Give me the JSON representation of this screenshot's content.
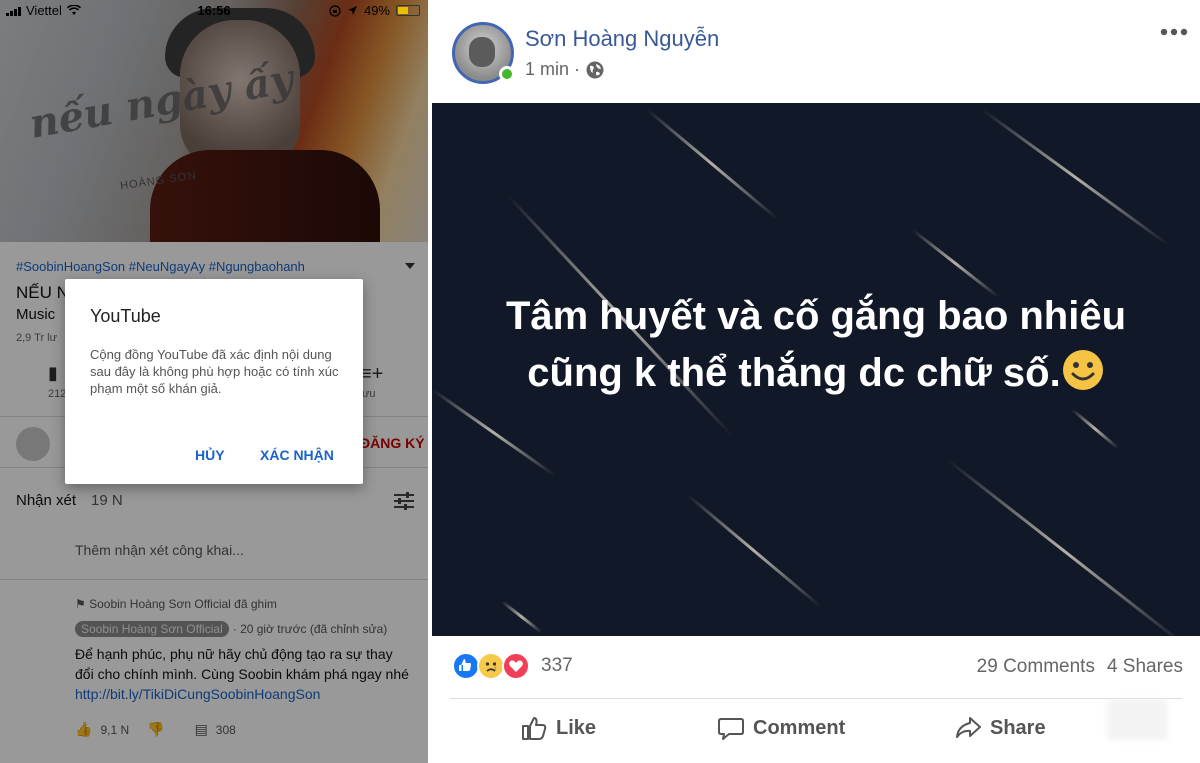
{
  "status_bar": {
    "carrier": "Viettel",
    "time": "16:56",
    "battery": "49%"
  },
  "youtube": {
    "thumbnail_title_art": "nếu ngày ấy",
    "thumbnail_artist_art": "HOÀNG SƠN",
    "hashtags": "#SoobinHoangSon #NeuNgayAy #Ngungbaohanh",
    "video_title_visible": "NẾU N",
    "video_subtitle_visible": "Music",
    "views_visible": "2,9 Tr lư",
    "like_count_visible": "212",
    "add_label_visible": "ưu",
    "subscribe_visible": "ĐĂNG KÝ",
    "comments_heading": "Nhận xét",
    "comments_count": "19 N",
    "add_comment_placeholder": "Thêm nhận xét công khai...",
    "pinned_by": "Soobin Hoàng Sơn Official đã ghim",
    "comment_author": "Soobin Hoàng Sơn Official",
    "comment_time": "· 20 giờ trước (đã chỉnh sửa)",
    "comment_text": "Để hạnh phúc, phụ nữ hãy chủ động tạo ra sự thay đổi cho chính mình. Cùng Soobin khám phá ngay nhé",
    "comment_link": "http://bit.ly/TikiDiCungSoobinHoangSon",
    "comment_likes": "9,1 N",
    "comment_replies": "308",
    "dialog": {
      "title": "YouTube",
      "body": "Cộng đồng YouTube đã xác định nội dung sau đây là không phù hợp hoặc có tính xúc phạm một số khán giả.",
      "cancel": "HỦY",
      "confirm": "XÁC NHẬN"
    }
  },
  "facebook": {
    "author": "Sơn Hoàng Nguyễn",
    "time": "1 min ·",
    "post_text": "Tâm huyết và cố gắng bao nhiêu cũng k thể thắng dc chữ số.",
    "reaction_count": "337",
    "comments": "29 Comments",
    "shares": "4 Shares",
    "like_label": "Like",
    "comment_label": "Comment",
    "share_label": "Share",
    "colors": {
      "link_blue": "#385898",
      "like_blue": "#1877f2",
      "love_red": "#f33e58",
      "online_green": "#42b72a",
      "image_bg": "#111827"
    }
  }
}
